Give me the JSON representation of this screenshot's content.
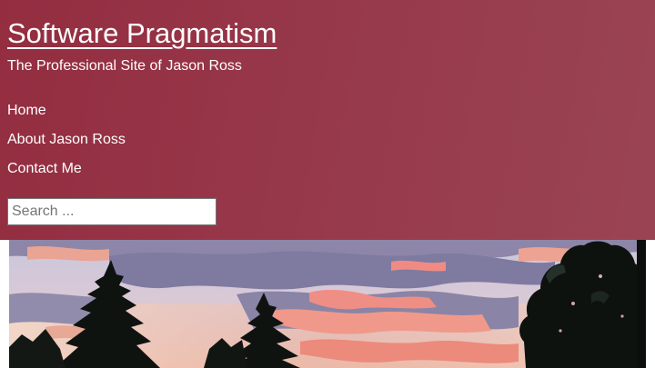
{
  "header": {
    "site_title": "Software Pragmatism",
    "tagline": "The Professional Site of Jason Ross",
    "background_color": "#96374a"
  },
  "nav": {
    "items": [
      {
        "label": "Home"
      },
      {
        "label": "About Jason Ross"
      },
      {
        "label": "Contact Me"
      }
    ]
  },
  "search": {
    "placeholder": "Search ..."
  },
  "hero": {
    "alt": "Sunset sky with pink clouds behind silhouetted trees"
  }
}
